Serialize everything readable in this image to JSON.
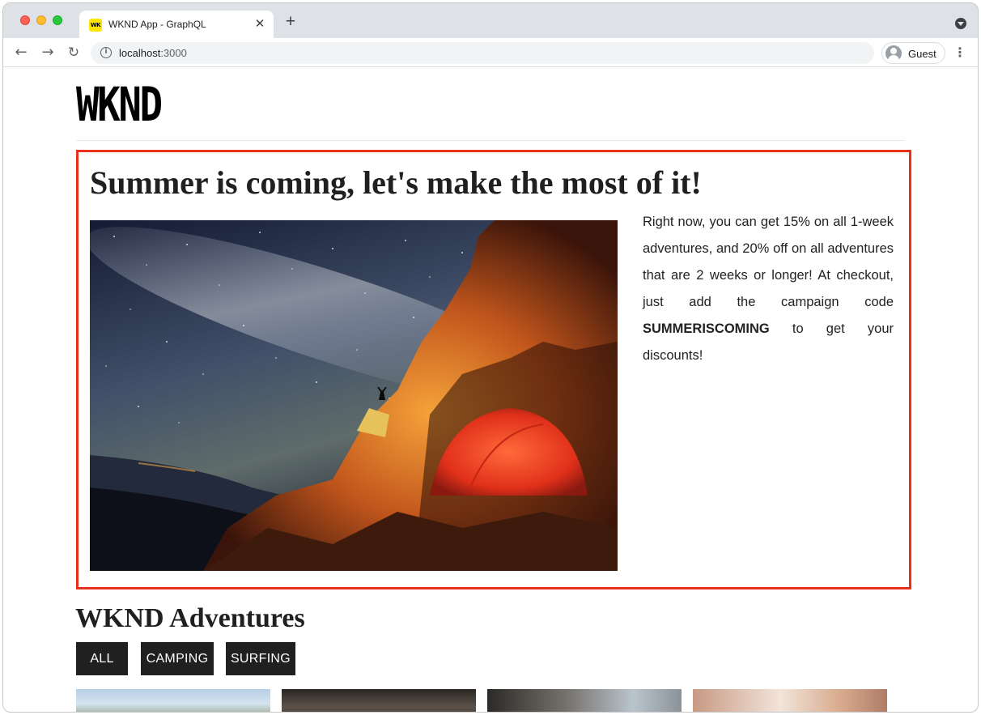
{
  "browser": {
    "tab_title": "WKND App - GraphQL",
    "favicon_text": "WK",
    "url_host": "localhost",
    "url_port": ":3000",
    "profile_label": "Guest",
    "icons": [
      "back-arrow-icon",
      "forward-arrow-icon",
      "reload-icon",
      "info-icon",
      "avatar-icon",
      "kebab-menu-icon",
      "close-icon",
      "plus-icon",
      "tab-menu-icon"
    ]
  },
  "site": {
    "logo": "WKND"
  },
  "promo": {
    "title": "Summer is coming, let's make the most of it!",
    "text_before_code": "Right now, you can get 15% on all 1-week adventures, and 20% off on all adventures that are 2 weeks or longer! At checkout, just add the campaign code ",
    "code": "SUMMERISCOMING",
    "text_after_code": " to get your discounts!",
    "highlight_color": "#e8301d"
  },
  "adventures": {
    "title": "WKND Adventures",
    "filters": [
      "ALL",
      "CAMPING",
      "SURFING"
    ]
  }
}
